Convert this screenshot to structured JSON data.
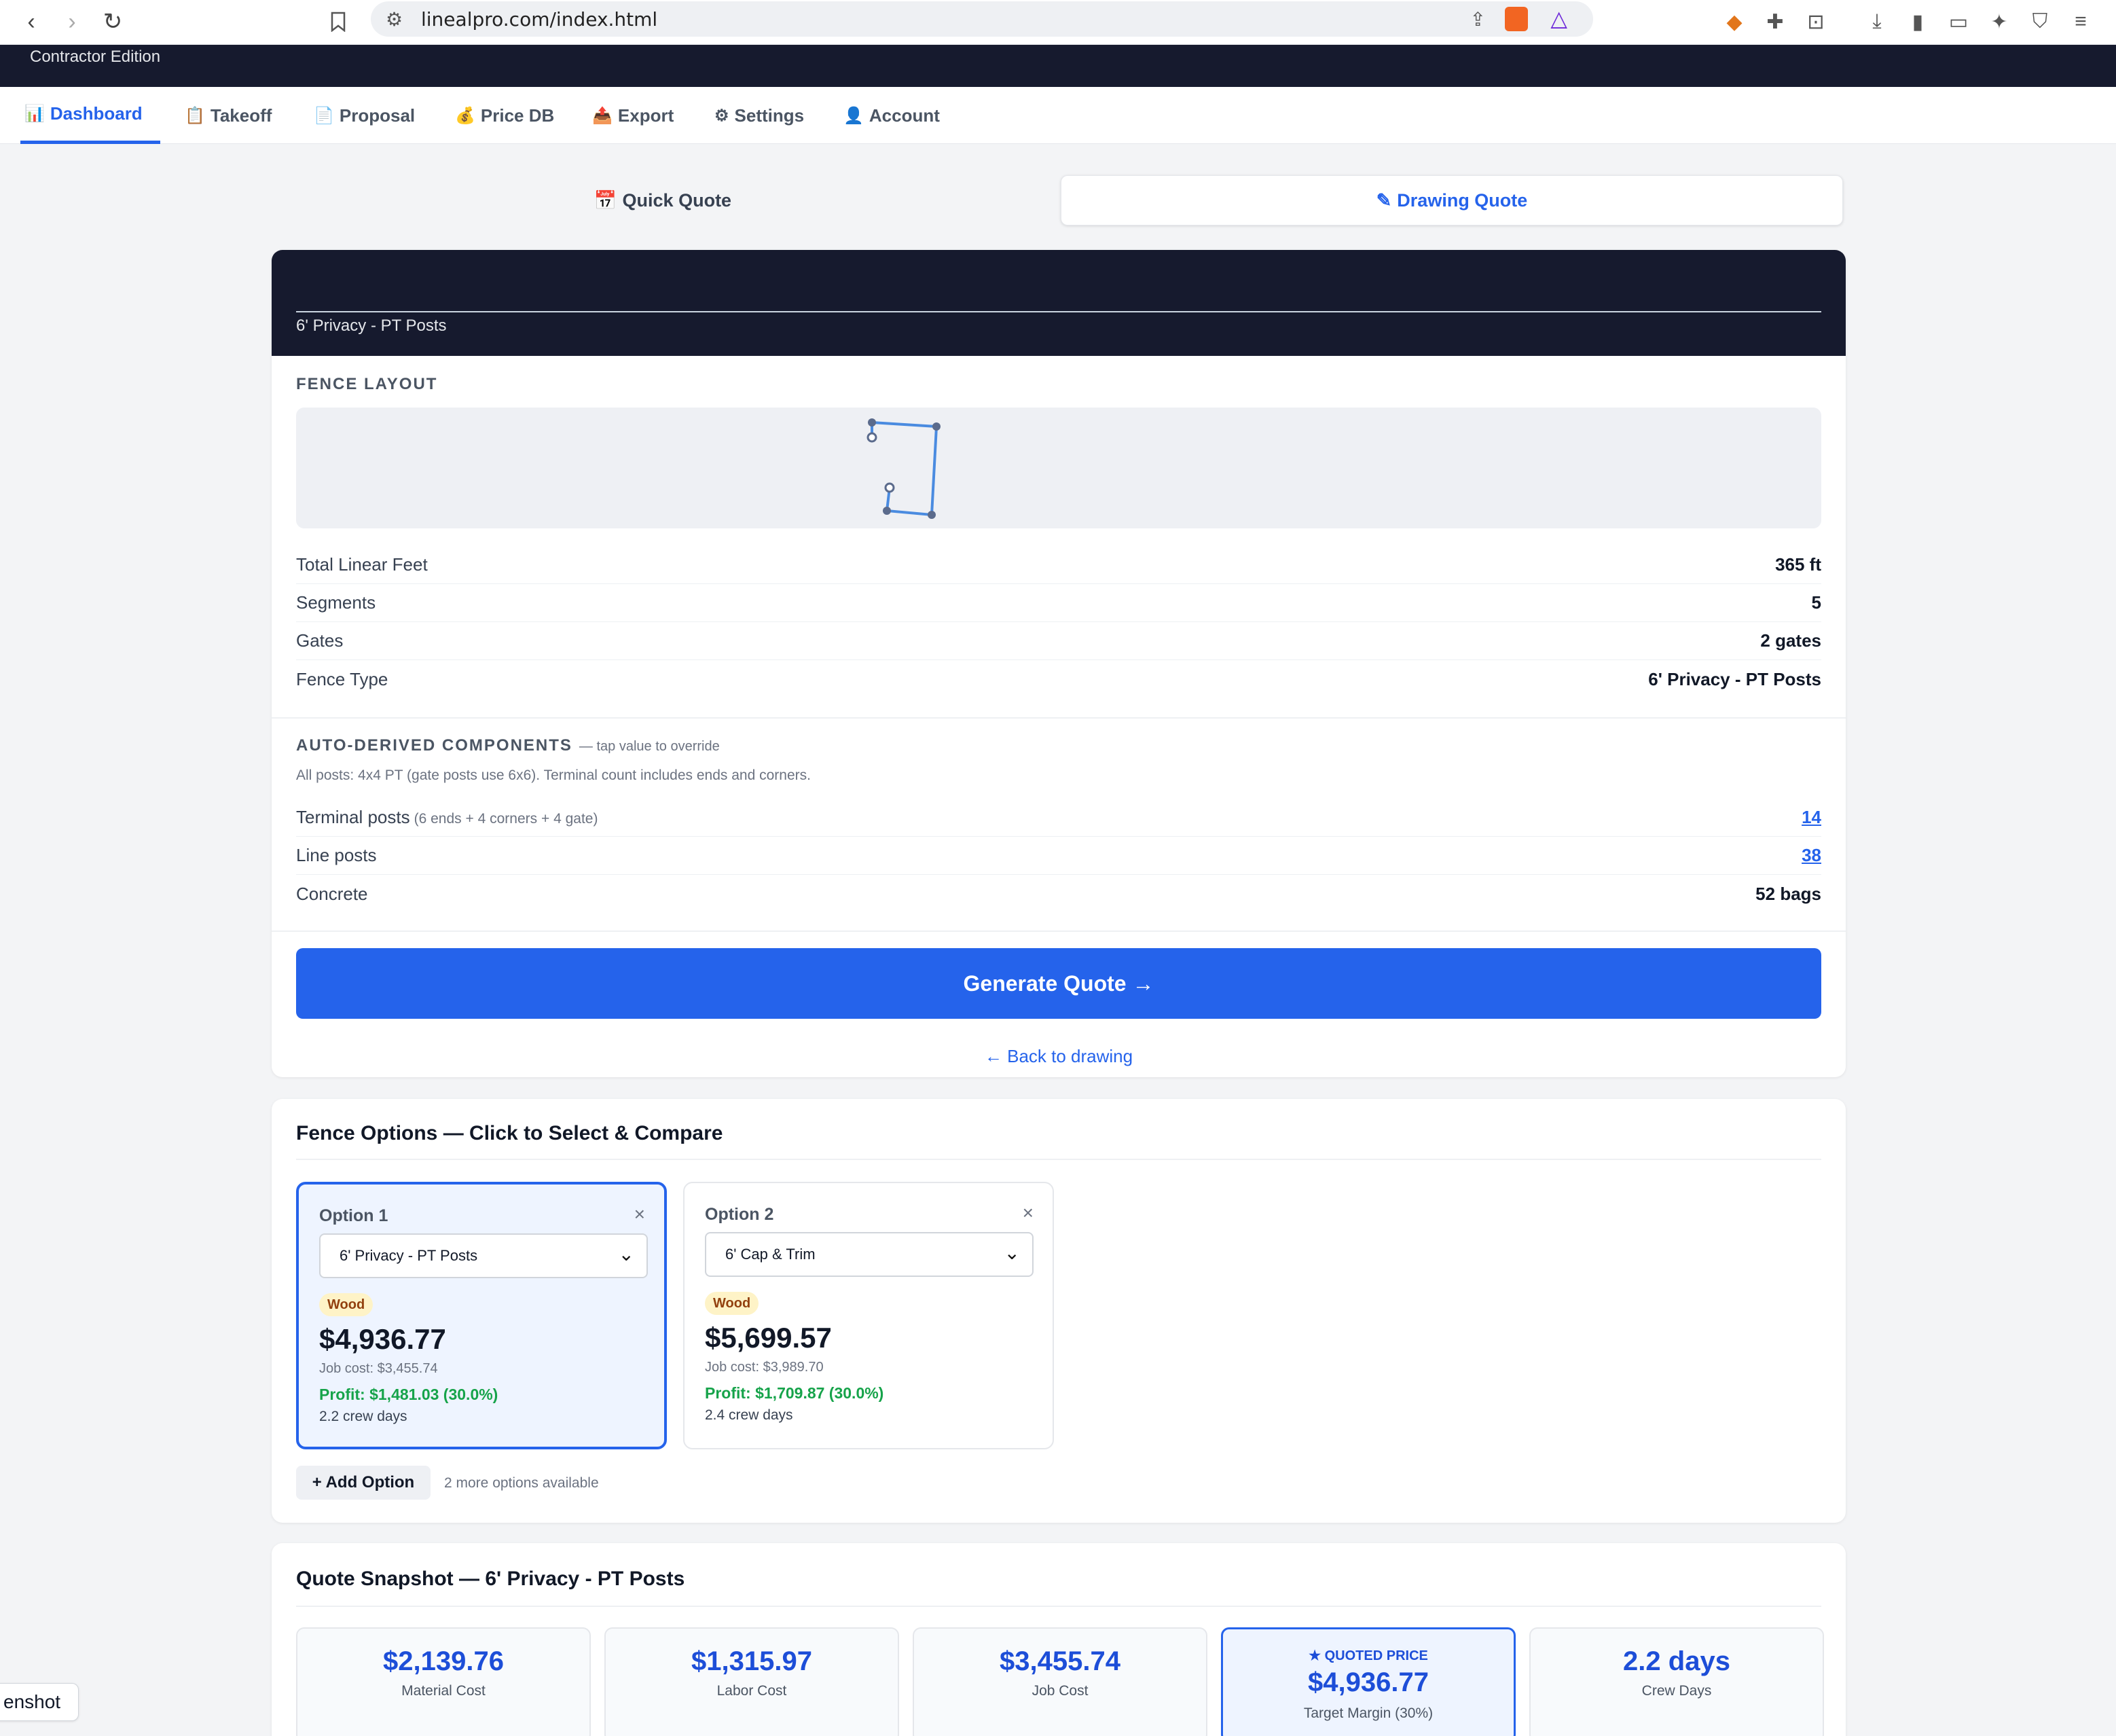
{
  "browser": {
    "url": "linealpro.com/index.html"
  },
  "header": {
    "edition": "Contractor Edition"
  },
  "tabs": [
    {
      "icon": "📊",
      "label": "Dashboard"
    },
    {
      "icon": "📋",
      "label": "Takeoff"
    },
    {
      "icon": "📄",
      "label": "Proposal"
    },
    {
      "icon": "💰",
      "label": "Price DB"
    },
    {
      "icon": "📤",
      "label": "Export"
    },
    {
      "icon": "⚙",
      "label": "Settings"
    },
    {
      "icon": "👤",
      "label": "Account"
    }
  ],
  "modes": {
    "quick": {
      "icon": "📅",
      "label": "Quick Quote"
    },
    "drawing": {
      "icon": "✎",
      "label": "Drawing Quote"
    }
  },
  "summary": {
    "fence_label": "6' Privacy - PT Posts",
    "layout_title": "FENCE LAYOUT",
    "stats": [
      {
        "label": "Total Linear Feet",
        "value": "365 ft"
      },
      {
        "label": "Segments",
        "value": "5"
      },
      {
        "label": "Gates",
        "value": "2 gates"
      },
      {
        "label": "Fence Type",
        "value": "6' Privacy - PT Posts"
      }
    ],
    "components_title": "AUTO-DERIVED COMPONENTS",
    "components_hint": "— tap value to override",
    "components_note": "All posts: 4x4 PT (gate posts use 6x6). Terminal count includes ends and corners.",
    "components": [
      {
        "label": "Terminal posts",
        "sub": "(6 ends + 4 corners + 4 gate)",
        "value": "14"
      },
      {
        "label": "Line posts",
        "sub": "",
        "value": "38"
      },
      {
        "label": "Concrete",
        "sub": "",
        "value": "52 bags"
      }
    ],
    "generate_label": "Generate Quote →",
    "back_label": "← Back to drawing"
  },
  "options": {
    "title": "Fence Options — Click to Select & Compare",
    "items": [
      {
        "name": "Option 1",
        "selected_type": "6' Privacy - PT Posts",
        "material": "Wood",
        "price": "$4,936.77",
        "job_cost": "Job cost: $3,455.74",
        "profit": "Profit: $1,481.03 (30.0%)",
        "crew": "2.2 crew days"
      },
      {
        "name": "Option 2",
        "selected_type": "6' Cap & Trim",
        "material": "Wood",
        "price": "$5,699.57",
        "job_cost": "Job cost: $3,989.70",
        "profit": "Profit: $1,709.87 (30.0%)",
        "crew": "2.4 crew days"
      }
    ],
    "add_label": "+ Add Option",
    "more_available": "2 more options available",
    "close_glyph": "×"
  },
  "snapshot": {
    "title": "Quote Snapshot — 6' Privacy - PT Posts",
    "cards": [
      {
        "value": "$2,139.76",
        "label": "Material Cost"
      },
      {
        "value": "$1,315.97",
        "label": "Labor Cost"
      },
      {
        "value": "$3,455.74",
        "label": "Job Cost"
      },
      {
        "kicker": "★ QUOTED PRICE",
        "value": "$4,936.77",
        "label": "Target Margin (30%)"
      },
      {
        "value": "2.2 days",
        "label": "Crew Days"
      }
    ]
  },
  "toast": {
    "text": "enshot"
  },
  "colors": {
    "accent": "#2563eb",
    "header_bg": "#161a2e",
    "profit": "#16a34a",
    "badge_bg": "#fef3c7"
  }
}
